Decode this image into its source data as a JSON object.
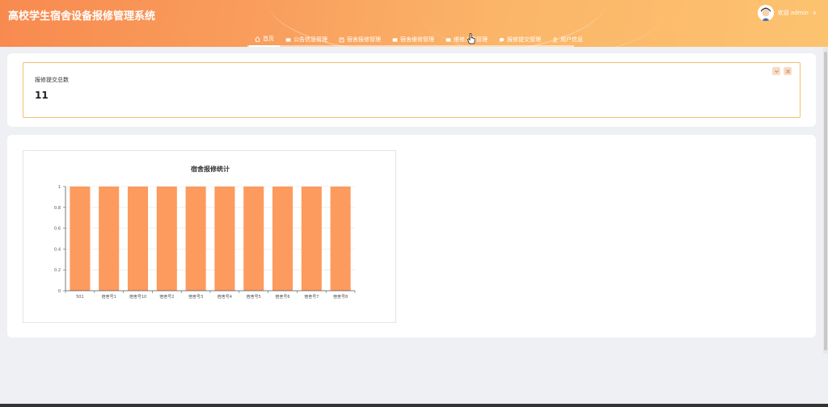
{
  "app": {
    "title": "高校学生宿舍设备报修管理系统"
  },
  "user": {
    "label": "欢迎 admin",
    "chevron": "∨"
  },
  "nav": {
    "items": [
      {
        "label": "首页",
        "icon": "home-icon"
      },
      {
        "label": "公告信息管理",
        "icon": "square-icon"
      },
      {
        "label": "宿舍报修管理",
        "icon": "doc-icon"
      },
      {
        "label": "宿舍维修管理",
        "icon": "square-icon"
      },
      {
        "label": "维修人员管理",
        "icon": "square-icon"
      },
      {
        "label": "报修提交管理",
        "icon": "chat-icon"
      },
      {
        "label": "用户信息",
        "icon": "user-icon"
      }
    ]
  },
  "stat": {
    "label": "报修提交总数",
    "value": "11"
  },
  "colors": {
    "accent": "#f9a05e",
    "bar": "#fd9a5e",
    "border": "#f0c070"
  },
  "chart_data": {
    "type": "bar",
    "title": "宿舍报修统计",
    "categories": [
      "501",
      "宿舍号1",
      "宿舍号10",
      "宿舍号2",
      "宿舍号3",
      "宿舍号4",
      "宿舍号5",
      "宿舍号6",
      "宿舍号7",
      "宿舍号8"
    ],
    "values": [
      1,
      1,
      1,
      1,
      1,
      1,
      1,
      1,
      1,
      1
    ],
    "ylim": [
      0,
      1
    ],
    "yticks": [
      "0",
      "0.2",
      "0.4",
      "0.6",
      "0.8",
      "1"
    ],
    "grid": true
  }
}
